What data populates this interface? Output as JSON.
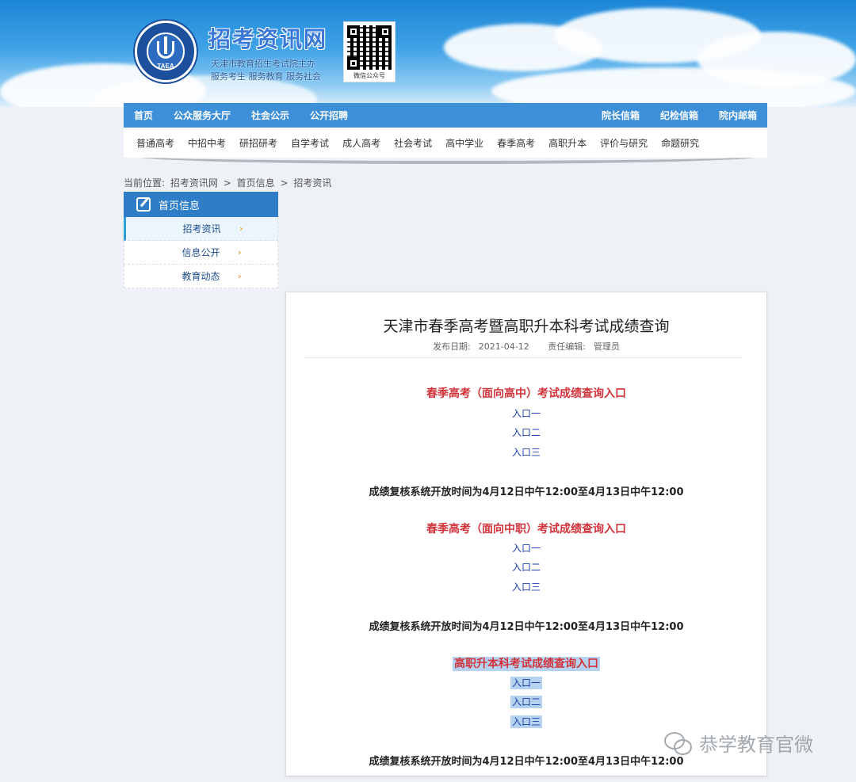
{
  "header": {
    "logo_text": "TAEA",
    "site_title": "招考资讯网",
    "slogan_line1": "天津市教育招生考试院主办",
    "slogan_line2": "服务考生 服务教育 服务社会",
    "qr_caption": "微信公众号"
  },
  "nav": {
    "main_left": [
      "首页",
      "公众服务大厅",
      "社会公示",
      "公开招聘"
    ],
    "main_right": [
      "院长信箱",
      "纪检信箱",
      "院内邮箱"
    ],
    "sub": [
      "普通高考",
      "中招中考",
      "研招研考",
      "自学考试",
      "成人高考",
      "社会考试",
      "高中学业",
      "春季高考",
      "高职升本",
      "评价与研究",
      "命题研究"
    ]
  },
  "breadcrumb": {
    "prefix": "当前位置:",
    "items": [
      "招考资讯网",
      "首页信息",
      "招考资讯"
    ],
    "separator": ">"
  },
  "sidebar": {
    "title": "首页信息",
    "items": [
      {
        "label": "招考资讯",
        "active": true
      },
      {
        "label": "信息公开",
        "active": false
      },
      {
        "label": "教育动态",
        "active": false
      }
    ],
    "arrow": "›"
  },
  "article": {
    "title": "天津市春季高考暨高职升本科考试成绩查询",
    "date_label": "发布日期:",
    "date": "2021-04-12",
    "editor_label": "责任编辑:",
    "editor": "管理员",
    "sections": [
      {
        "title": "春季高考（面向高中）考试成绩查询入口",
        "entries": [
          "入口一",
          "入口二",
          "入口三"
        ],
        "notice": "成绩复核系统开放时间为4月12日中午12:00至4月13日中午12:00"
      },
      {
        "title": "春季高考（面向中职）考试成绩查询入口",
        "entries": [
          "入口一",
          "入口二",
          "入口三"
        ],
        "notice": "成绩复核系统开放时间为4月12日中午12:00至4月13日中午12:00"
      },
      {
        "title": "高职升本科考试成绩查询入口",
        "entries": [
          "入口一",
          "入口二",
          "入口三"
        ],
        "notice": "成绩复核系统开放时间为4月12日中午12:00至4月13日中午12:00"
      }
    ]
  },
  "watermark": "恭学教育官微",
  "colors": {
    "nav_blue": "#3d8fd8",
    "sidebar_blue": "#2e7dc6",
    "section_red": "#d2323a",
    "link_blue": "#1a3fa8",
    "highlight": "#b5d3f0"
  }
}
